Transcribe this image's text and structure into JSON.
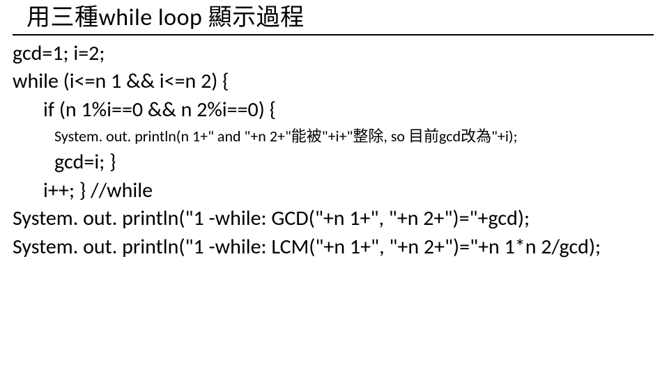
{
  "title": "用三種while loop 顯示過程",
  "lines": {
    "l1": "gcd=1; i=2;",
    "l2": "while (i<=n 1 && i<=n 2) {",
    "l3": "if (n 1%i==0 && n 2%i==0) {",
    "l4": "System. out. println(n 1+\" and \"+n 2+\"能被\"+i+\"整除, so 目前gcd改為\"+i);",
    "l5": "gcd=i; }",
    "l6": "i++; } //while",
    "l7": "System. out. println(\"1 -while: GCD(\"+n 1+\", \"+n 2+\")=\"+gcd);",
    "l8": "System. out. println(\"1 -while: LCM(\"+n 1+\", \"+n 2+\")=\"+n 1*n 2/gcd);"
  }
}
